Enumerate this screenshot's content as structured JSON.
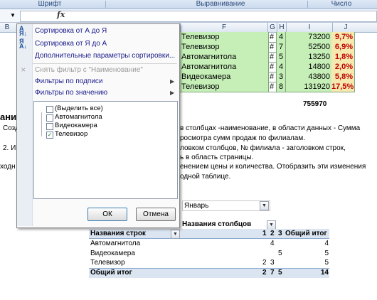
{
  "ribbon": {
    "groups": [
      "Шрифт",
      "Выравнивание",
      "Число"
    ]
  },
  "formula_bar": {
    "fx_label": "fx"
  },
  "column_headers": [
    "B",
    "F",
    "G",
    "H",
    "I",
    "J"
  ],
  "data_rows": [
    {
      "name": "Телевизор",
      "g": "#",
      "h": "4",
      "i": "73200",
      "j": "9,7%"
    },
    {
      "name": "Телевизор",
      "g": "#",
      "h": "7",
      "i": "52500",
      "j": "6,9%"
    },
    {
      "name": "Автомагнитола",
      "g": "#",
      "h": "5",
      "i": "13250",
      "j": "1,8%"
    },
    {
      "name": "Автомагнитола",
      "g": "#",
      "h": "4",
      "i": "14800",
      "j": "2,0%"
    },
    {
      "name": "Видеокамера",
      "g": "#",
      "h": "3",
      "i": "43800",
      "j": "5,8%"
    },
    {
      "name": "Телевизор",
      "g": "#",
      "h": "8",
      "i": "131920",
      "j": "17,5%"
    }
  ],
  "total_value": "755970",
  "menu": {
    "sort_az": "Сортировка от А до Я",
    "sort_za": "Сортировка от Я до А",
    "more_sort": "Дополнительные параметры сортировки...",
    "clear_filter": "Снять фильтр с \"Наименование\"",
    "label_filters": "Фильтры по подписи",
    "value_filters": "Фильтры по значению",
    "list": [
      {
        "label": "(Выделить все)",
        "checked": false
      },
      {
        "label": "Автомагнитола",
        "checked": false
      },
      {
        "label": "Видеокамера",
        "checked": false
      },
      {
        "label": "Телевизор",
        "checked": true
      }
    ],
    "ok": "ОК",
    "cancel": "Отмена"
  },
  "sheet_text": {
    "heading_partial": "ани",
    "line1_left": "Созд",
    "line1_right": "в столбцах -наименование, в области данных - Сумма",
    "line2": "росмотра сумм продаж по филиалам.",
    "line3_left": "2. Из",
    "line3_right": "ловком столбцов, № филиала - заголовком строк,",
    "line4": "ь в область страницы.",
    "line5_left": "ходн",
    "line5_right": "енением цены и количества. Отобразить эти изменения",
    "line6": "одной таблице."
  },
  "pivot": {
    "page_filter_value": "Январь",
    "col_fields_label": "Названия столбцов",
    "row_labels_header": "Названия строк",
    "col_headers": [
      "1",
      "2",
      "3",
      "Общий итог"
    ],
    "rows": [
      {
        "label": "Автомагнитола",
        "c1": "",
        "c2": "4",
        "c3": "",
        "total": "4"
      },
      {
        "label": "Видеокамера",
        "c1": "",
        "c2": "",
        "c3": "5",
        "total": "5"
      },
      {
        "label": "Телевизор",
        "c1": "2",
        "c2": "3",
        "c3": "",
        "total": "5"
      }
    ],
    "grand_total": {
      "label": "Общий итог",
      "c1": "2",
      "c2": "7",
      "c3": "5",
      "total": "14"
    }
  }
}
